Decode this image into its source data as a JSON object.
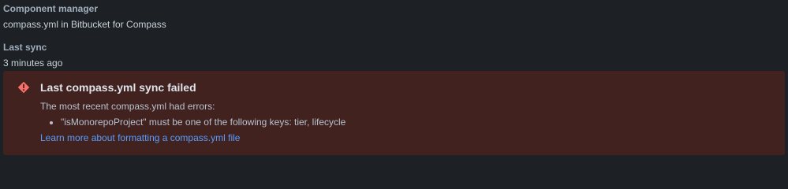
{
  "component_manager": {
    "label": "Component manager",
    "value": "compass.yml in Bitbucket for Compass"
  },
  "last_sync": {
    "label": "Last sync",
    "value": "3 minutes ago"
  },
  "error": {
    "icon": "error-icon",
    "title": "Last compass.yml sync failed",
    "description": "The most recent compass.yml had errors:",
    "items": [
      "\"isMonorepoProject\" must be one of the following keys: tier, lifecycle"
    ],
    "link_text": "Learn more about formatting a compass.yml file"
  },
  "colors": {
    "background": "#1d2125",
    "error_background": "#42221f",
    "error_icon": "#f87168",
    "link": "#579dff"
  }
}
